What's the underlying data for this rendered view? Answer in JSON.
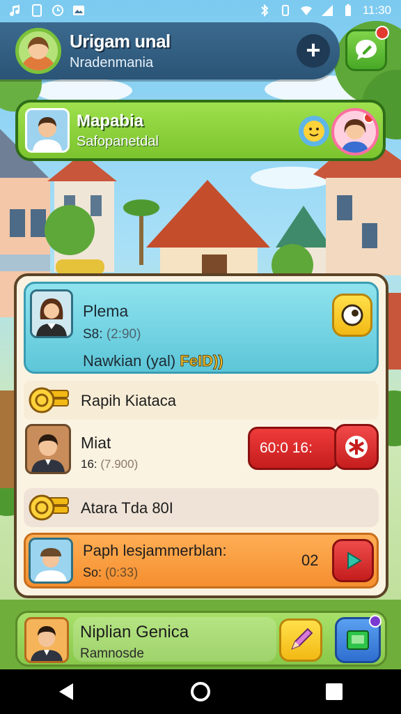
{
  "status_bar": {
    "time": "11:30"
  },
  "header": {
    "title": "Urigam unal",
    "subtitle": "Nradenmania",
    "plus_label": "+"
  },
  "green_card": {
    "title": "Mapabia",
    "subtitle": "Safopanetdal"
  },
  "panel": {
    "row1": {
      "name": "Plema",
      "meta_prefix": "S8:",
      "meta_value": "(2:90)",
      "desc": "Nawkian (yal)",
      "desc_tag": "FeID))"
    },
    "row2": {
      "label": "Rapih Kiataca"
    },
    "row3": {
      "name": "Miat",
      "meta_prefix": "16:",
      "meta_value": "(7.900)",
      "timer": "60:0 16:"
    },
    "row4": {
      "label": "Atara Tda 80I"
    },
    "row5": {
      "name": "Paph lesjammerblan:",
      "meta_prefix": "So:",
      "meta_value": "(0:33)",
      "count": "02"
    }
  },
  "bottom_card": {
    "name": "Niplian Genica",
    "subtitle": "Ramnosde"
  },
  "colors": {
    "header_bg": "#2b5476",
    "green_card": "#7cc42e",
    "panel_bg": "#fbf3e2",
    "row1_bg": "#5cc6d8",
    "row5_bg": "#f58f2f",
    "timer_red": "#c51d1d",
    "yellow_btn": "#f2b914"
  }
}
